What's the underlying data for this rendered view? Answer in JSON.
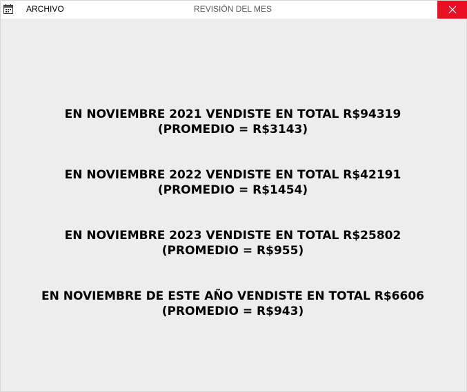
{
  "window": {
    "title": "REVISIÓN DEL MES",
    "menu_label": "ARCHIVO",
    "app_icon": "calendar-icon",
    "close_icon": "close-icon",
    "close_color": "#e81123"
  },
  "reports": [
    {
      "total_text": "EN NOVIEMBRE 2021 VENDISTE EN TOTAL R$94319",
      "average_text": "(PROMEDIO = R$3143)"
    },
    {
      "total_text": "EN NOVIEMBRE 2022 VENDISTE EN TOTAL R$42191",
      "average_text": "(PROMEDIO = R$1454)"
    },
    {
      "total_text": "EN NOVIEMBRE 2023 VENDISTE EN TOTAL R$25802",
      "average_text": "(PROMEDIO = R$955)"
    },
    {
      "total_text": "EN NOVIEMBRE DE ESTE AÑO VENDISTE EN TOTAL R$6606",
      "average_text": "(PROMEDIO = R$943)"
    }
  ]
}
